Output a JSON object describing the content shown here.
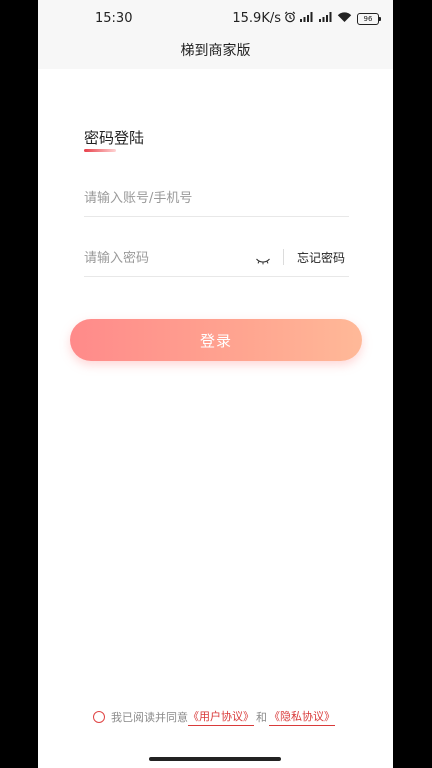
{
  "status_bar": {
    "time": "15:30",
    "net_speed": "15.9K/s",
    "battery_level": "96",
    "icons": [
      "alarm-icon",
      "signal-icon",
      "signal-icon",
      "wifi-icon",
      "battery-icon"
    ]
  },
  "header": {
    "title": "梯到商家版"
  },
  "login": {
    "title": "密码登陆",
    "account_placeholder": "请输入账号/手机号",
    "password_placeholder": "请输入密码",
    "forgot_label": "忘记密码",
    "submit_label": "登录"
  },
  "agreement": {
    "prefix": "我已阅读并同意",
    "user_agreement": "《用户协议》",
    "and": "和",
    "privacy_policy": "《隐私协议》"
  },
  "colors": {
    "accent": "#d93a3a",
    "button_gradient_start": "#ff8a8a",
    "button_gradient_end": "#ffb998",
    "topbar_bg": "#f7f7f7"
  }
}
